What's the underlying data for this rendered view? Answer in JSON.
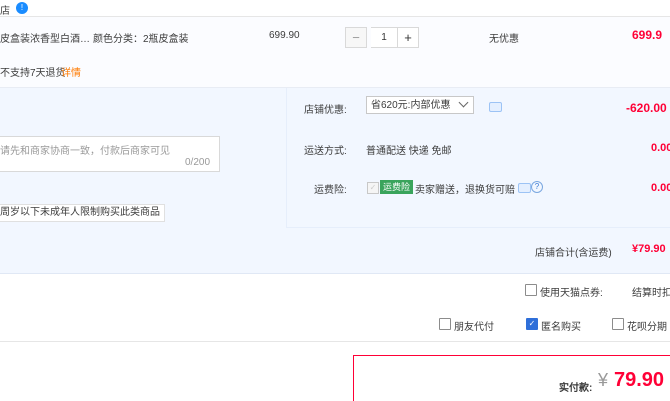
{
  "shop": {
    "name": "店"
  },
  "item": {
    "title": "皮盒装浓香型白酒…",
    "sku": "颜色分类：2瓶皮盒装",
    "price": "699.90",
    "quantity": "1",
    "discount": "无优惠",
    "total": "699.9",
    "return_note": "不支持7天退货",
    "return_link": "详情"
  },
  "message": {
    "placeholder": "请先和商家协商一致，付款后商家可见",
    "count": "0/200"
  },
  "age_note": "周岁以下未成年人限制购买此类商品",
  "coupon": {
    "label": "店铺优惠:",
    "selected": "省620元:内部优惠",
    "amount": "-620.00"
  },
  "shipping": {
    "label": "运送方式:",
    "value": "普通配送 快递 免邮",
    "amount": "0.00"
  },
  "insurance": {
    "label": "运费险:",
    "badge": "运费险",
    "desc": "卖家赠送，退换货可赔",
    "amount": "0.00"
  },
  "subtotal": {
    "label": "店铺合计(含运费)",
    "amount": "¥79.90"
  },
  "tmall_points": {
    "label": "使用天猫点券:",
    "checked": false
  },
  "settle_label": "结算时扣",
  "options": {
    "friend_pay": {
      "label": "朋友代付",
      "checked": false
    },
    "anonymous": {
      "label": "匿名购买",
      "checked": true
    },
    "huabei": {
      "label": "花呗分期",
      "checked": false
    }
  },
  "payment": {
    "label": "实付款:",
    "currency": "¥",
    "amount": "79.90"
  }
}
